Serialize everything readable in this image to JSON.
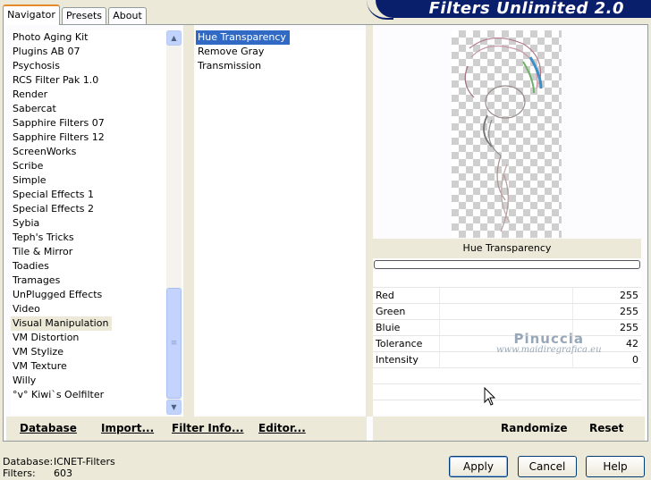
{
  "app": {
    "title": "Filters Unlimited 2.0"
  },
  "tabs": [
    {
      "label": "Navigator",
      "active": true
    },
    {
      "label": "Presets"
    },
    {
      "label": "About"
    }
  ],
  "categories": [
    "Photo Aging Kit",
    "Plugins AB 07",
    "Psychosis",
    "RCS Filter Pak 1.0",
    "Render",
    "Sabercat",
    "Sapphire Filters 07",
    "Sapphire Filters 12",
    "ScreenWorks",
    "Scribe",
    "Simple",
    "Special Effects 1",
    "Special Effects 2",
    "Sybia",
    "Teph's Tricks",
    "Tile & Mirror",
    "Toadies",
    "Tramages",
    "UnPlugged Effects",
    "Video",
    "Visual Manipulation",
    "VM Distortion",
    "VM Stylize",
    "VM Texture",
    "Willy",
    "°v° Kiwi`s Oelfilter"
  ],
  "selected_category": "Visual Manipulation",
  "filters": [
    "Hue Transparency",
    "Remove Gray",
    "Transmission"
  ],
  "selected_filter": "Hue Transparency",
  "filter_title": "Hue Transparency",
  "sliders": [
    {
      "label": "Red",
      "value": "255"
    },
    {
      "label": "Green",
      "value": "255"
    },
    {
      "label": "Bluie",
      "value": "255"
    },
    {
      "label": "Tolerance",
      "value": "42"
    },
    {
      "label": "Intensity",
      "value": "0"
    }
  ],
  "watermark": {
    "line1": "Pinuccia",
    "line2": "www.maidiregrafica.eu"
  },
  "bottom_left": {
    "database": "Database",
    "import": "Import...",
    "filter_info": "Filter Info...",
    "editor": "Editor..."
  },
  "bottom_right": {
    "randomize": "Randomize",
    "reset": "Reset"
  },
  "status": {
    "database_label": "Database:",
    "database_value": "ICNET-Filters",
    "filters_label": "Filters:",
    "filters_value": "603"
  },
  "buttons": {
    "apply": "Apply",
    "cancel": "Cancel",
    "help": "Help"
  },
  "icons": {
    "scroll_up": "arrow-up-icon",
    "scroll_down": "arrow-down-icon",
    "grip": "grip-icon"
  }
}
